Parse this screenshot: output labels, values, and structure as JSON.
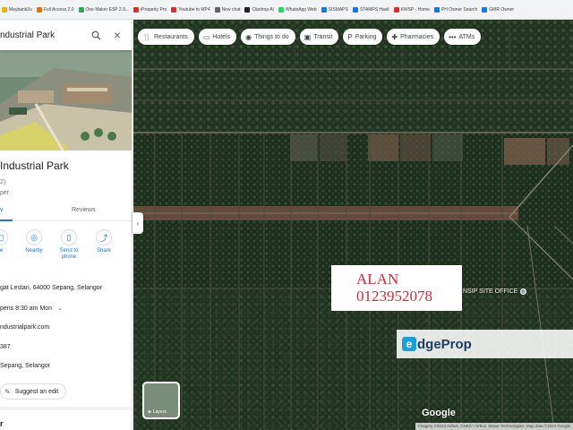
{
  "bookmarks": [
    {
      "label": "Maybank2u",
      "color": "#f2b400"
    },
    {
      "label": "Full Access 2.0",
      "color": "#e8710a"
    },
    {
      "label": "One Maker ESP 2.0...",
      "color": "#34a853"
    },
    {
      "label": "iProperty Pro",
      "color": "#d93025"
    },
    {
      "label": "Youtube to MP4",
      "color": "#d93025"
    },
    {
      "label": "New chat",
      "color": "#5f6368"
    },
    {
      "label": "Clipdrop AI",
      "color": "#202124"
    },
    {
      "label": "WhatsApp Web",
      "color": "#25d366"
    },
    {
      "label": "SISMAPS",
      "color": "#1a73e8"
    },
    {
      "label": "STAMPS Hasil",
      "color": "#1a73e8"
    },
    {
      "label": "KWSP - Home",
      "color": "#d93025"
    },
    {
      "label": "PH Owner Search",
      "color": "#1a73e8"
    },
    {
      "label": "GMR Owner",
      "color": "#1a73e8"
    }
  ],
  "search": {
    "value": "ndustrial Park"
  },
  "place": {
    "title": "Industrial Park",
    "meta1": "2)",
    "meta2": "per"
  },
  "tabs": {
    "overview": "v",
    "reviews": "Reviews"
  },
  "actions": [
    {
      "label": "ve",
      "icon": "◧"
    },
    {
      "label": "Nearby",
      "icon": "◎"
    },
    {
      "label": "Send to phone",
      "icon": "▯"
    },
    {
      "label": "Share",
      "icon": "⤴"
    }
  ],
  "info": {
    "address": "gat Lestari, 64000 Sepang, Selangor",
    "hours": "pens 8:30 am Mon",
    "website": "ndustrialpark.com",
    "phone": "387",
    "plus_code": "Sepang, Selangor"
  },
  "suggest_edit": "Suggest an edit",
  "sub_heading": "r",
  "chips": [
    {
      "label": "Restaurants",
      "icon": "🍴"
    },
    {
      "label": "Hotels",
      "icon": "▭"
    },
    {
      "label": "Things to do",
      "icon": "◉"
    },
    {
      "label": "Transit",
      "icon": "▣"
    },
    {
      "label": "Parking",
      "icon": "P"
    },
    {
      "label": "Pharmacies",
      "icon": "✚"
    },
    {
      "label": "ATMs",
      "icon": "•••"
    }
  ],
  "overlay": {
    "name": "ALAN",
    "phone": "0123952078"
  },
  "watermark": {
    "mark": "e",
    "text": "dgeProp"
  },
  "map_label": "NSIP SITE OFFICE",
  "layers_label": "Layers",
  "google": "Google",
  "attribution": "Imagery ©2023 Airbus, CNES / Airbus, Maxar Technologies, Map data ©2023 Google",
  "colors": {
    "accent": "#1a73e8",
    "overlay_text": "#d6263a",
    "edgeprop_blue": "#1b9fd8"
  }
}
